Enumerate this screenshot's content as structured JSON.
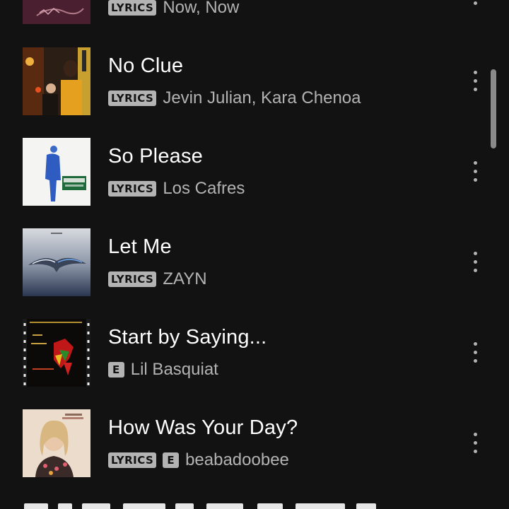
{
  "tracks": [
    {
      "title": "",
      "badges": [
        "LYRICS"
      ],
      "artist": "Now, Now",
      "art": "dark-pink-album-art"
    },
    {
      "title": "No Clue",
      "badges": [
        "LYRICS"
      ],
      "artist": "Jevin Julian, Kara Chenoa",
      "art": "night-street-photo-art"
    },
    {
      "title": "So Please",
      "badges": [
        "LYRICS"
      ],
      "artist": "Los Cafres",
      "art": "blue-figure-white-art"
    },
    {
      "title": "Let Me",
      "badges": [
        "LYRICS"
      ],
      "artist": "ZAYN",
      "art": "winged-sky-art"
    },
    {
      "title": "Start by Saying...",
      "badges": [
        "E"
      ],
      "artist": "Lil Basquiat",
      "art": "film-strip-art"
    },
    {
      "title": "How Was Your Day?",
      "badges": [
        "LYRICS",
        "E"
      ],
      "artist": "beabadoobee",
      "art": "girl-portrait-art"
    }
  ],
  "colors": {
    "background": "#121212",
    "primary_text": "#ffffff",
    "secondary_text": "#b3b3b3",
    "scrollbar": "#8a8a8a"
  },
  "icons": {
    "more": "vertical-ellipsis-icon"
  }
}
